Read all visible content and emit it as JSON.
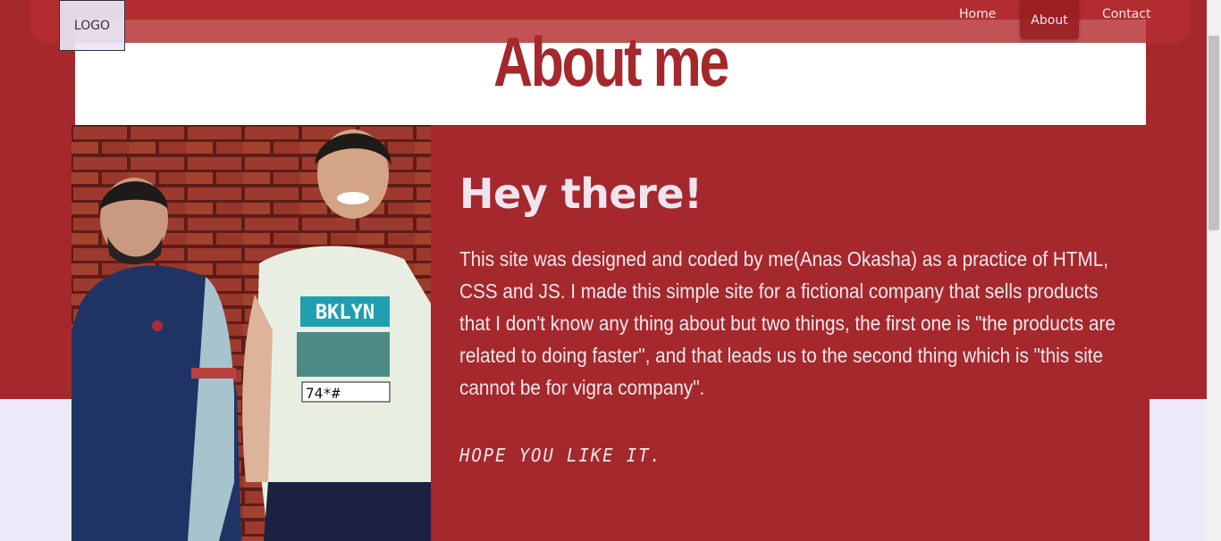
{
  "logo": {
    "text": "LOGO"
  },
  "nav": {
    "items": [
      {
        "label": "Home"
      },
      {
        "label": "About"
      },
      {
        "label": "Contact"
      }
    ],
    "active": "About"
  },
  "header": {
    "title": "About me"
  },
  "about": {
    "greeting": "Hey there!",
    "paragraph": "This site was designed and coded by me(Anas Okasha) as a practice of HTML, CSS and JS. I made this simple site for a fictional company that sells products that I don't know any thing about but two things, the first one is \"the products are related to doing faster\", and that leads us to the second thing which is \"this site cannot be for vigra company\".",
    "sign_off": "HOPE YOU LIKE IT.",
    "photo_shirt_text": "BKLYN",
    "photo_shirt_subtext": "74*#"
  },
  "colors": {
    "brand_red": "#a4282c",
    "nav_red": "#b32d30",
    "background": "#eceaf8",
    "text_light": "#f4e6ea"
  }
}
